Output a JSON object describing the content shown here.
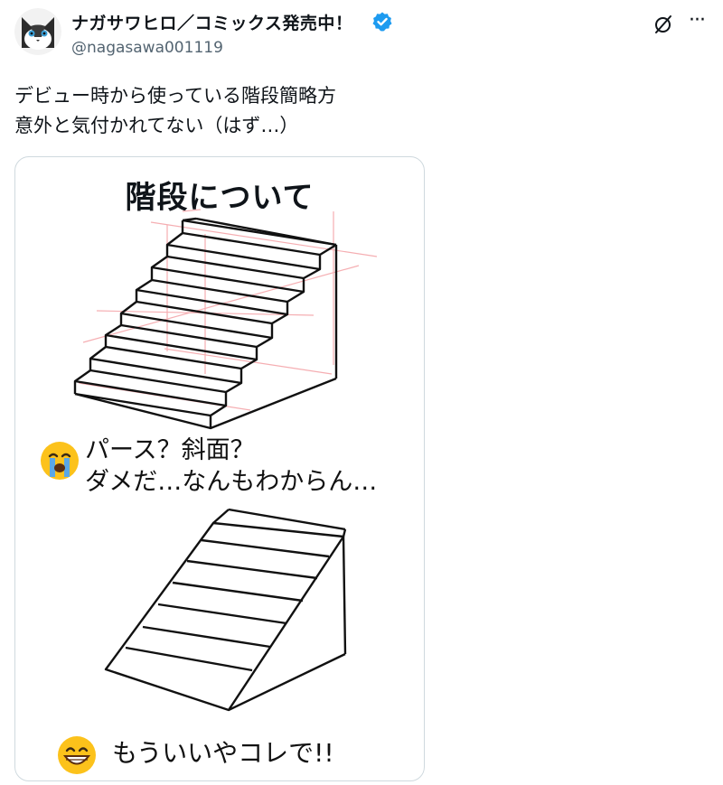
{
  "author": {
    "display_name": "ナガサワヒロ／コミックス発売中！",
    "handle": "@nagasawa001119"
  },
  "icons": {
    "verified": "verified-badge-icon",
    "grok": "grok-icon",
    "more": "more-options-icon"
  },
  "colors": {
    "verified": "#1d9bf0",
    "guide_lines": "#f4a6aa",
    "handle": "#536471"
  },
  "tweet": {
    "text": "デビュー時から使っている階段簡略方\n意外と気付かれてない（はず…）"
  },
  "image": {
    "title": "階段について",
    "caption_1_line_1": "パース？斜面？",
    "caption_1_line_2": "ダメだ…なんもわからん…",
    "caption_2": "もういいやコレで!!"
  },
  "more_glyph": "···"
}
